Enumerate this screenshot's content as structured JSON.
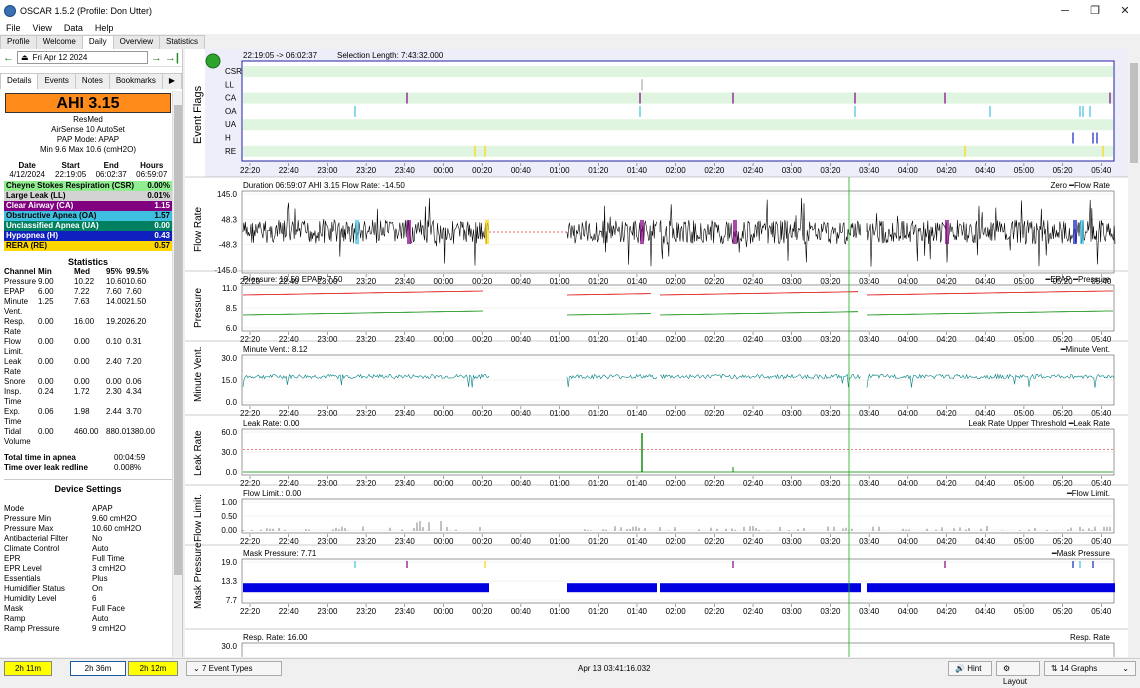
{
  "window": {
    "title": "OSCAR 1.5.2 (Profile: Don Utter)",
    "min": "─",
    "max": "❐",
    "close": "✕"
  },
  "menu": [
    "File",
    "View",
    "Data",
    "Help"
  ],
  "tabs": [
    "Profile",
    "Welcome",
    "Daily",
    "Overview",
    "Statistics"
  ],
  "date": {
    "value": "Fri Apr 12 2024"
  },
  "subtabs": [
    "Details",
    "Events",
    "Notes",
    "Bookmarks"
  ],
  "summary": {
    "ahi": "AHI 3.15",
    "brand": "ResMed",
    "model": "AirSense 10 AutoSet",
    "mode": "PAP Mode: APAP",
    "pressure": "Min 9.6 Max 10.6 (cmH2O)"
  },
  "session": {
    "headers": [
      "Date",
      "Start",
      "End",
      "Hours"
    ],
    "row": [
      "4/12/2024",
      "22:19:05",
      "06:02:37",
      "06:59:07"
    ]
  },
  "events": [
    {
      "label": "Cheyne Stokes Respiration (CSR)",
      "value": "0.00%",
      "color": "#90ee90"
    },
    {
      "label": "Large Leak (LL)",
      "value": "0.01%",
      "color": "#d3d3d3"
    },
    {
      "label": "Clear Airway (CA)",
      "value": "1.15",
      "color": "#800080",
      "fg": "#fff"
    },
    {
      "label": "Obstructive Apnea (OA)",
      "value": "1.57",
      "color": "#40c0e0"
    },
    {
      "label": "Unclassified Apnea (UA)",
      "value": "0.00",
      "color": "#008060",
      "fg": "#fff"
    },
    {
      "label": "Hypopnea (H)",
      "value": "0.43",
      "color": "#1020c0",
      "fg": "#fff"
    },
    {
      "label": "RERA (RE)",
      "value": "0.57",
      "color": "#ffd700"
    }
  ],
  "statistics": {
    "title": "Statistics",
    "headers": [
      "Channel",
      "Min",
      "Med",
      "95%",
      "99.5%"
    ],
    "rows": [
      [
        "Pressure",
        "9.00",
        "10.22",
        "10.60",
        "10.60"
      ],
      [
        "EPAP",
        "6.00",
        "7.22",
        "7.60",
        "7.60"
      ],
      [
        "Minute Vent.",
        "1.25",
        "7.63",
        "14.00",
        "21.50"
      ],
      [
        "Resp. Rate",
        "0.00",
        "16.00",
        "19.20",
        "26.20"
      ],
      [
        "Flow Limit.",
        "0.00",
        "0.00",
        "0.10",
        "0.31"
      ],
      [
        "Leak Rate",
        "0.00",
        "0.00",
        "2.40",
        "7.20"
      ],
      [
        "Snore",
        "0.00",
        "0.00",
        "0.00",
        "0.06"
      ],
      [
        "Insp. Time",
        "0.24",
        "1.72",
        "2.30",
        "4.34"
      ],
      [
        "Exp. Time",
        "0.06",
        "1.98",
        "2.44",
        "3.70"
      ],
      [
        "Tidal Volume",
        "0.00",
        "460.00",
        "880.0",
        "1380.00"
      ]
    ],
    "apnea_label": "Total time in apnea",
    "apnea_value": "00:04:59",
    "leak_label": "Time over leak redline",
    "leak_value": "0.008%"
  },
  "device": {
    "title": "Device Settings",
    "rows": [
      [
        "Mode",
        "APAP"
      ],
      [
        "Pressure Min",
        "9.60 cmH2O"
      ],
      [
        "Pressure Max",
        "10.60 cmH2O"
      ],
      [
        "Antibacterial Filter",
        "No"
      ],
      [
        "Climate Control",
        "Auto"
      ],
      [
        "EPR",
        "Full Time"
      ],
      [
        "EPR Level",
        "3 cmH2O"
      ],
      [
        "Essentials",
        "Plus"
      ],
      [
        "Humidifier Status",
        "On"
      ],
      [
        "Humidity Level",
        "6"
      ],
      [
        "Mask",
        "Full Face"
      ],
      [
        "Ramp",
        "Auto"
      ],
      [
        "Ramp Pressure",
        "9 cmH2O"
      ]
    ]
  },
  "bottom": {
    "btn1": "2h 11m",
    "btn2": "2h 36m",
    "btn3": "2h 12m",
    "event_types": "7 Event Types",
    "timestamp": "Apr 13 03:41:16.032",
    "hint": "Hint",
    "layout": "Layout",
    "graphs": "14 Graphs"
  },
  "time_ticks": [
    "22:20",
    "22:40",
    "23:00",
    "23:20",
    "23:40",
    "00:00",
    "00:20",
    "00:40",
    "01:00",
    "01:20",
    "01:40",
    "02:00",
    "02:20",
    "02:40",
    "03:00",
    "03:20",
    "03:40",
    "04:00",
    "04:20",
    "04:40",
    "05:00",
    "05:20",
    "05:40"
  ],
  "event_flags": {
    "label": "Event Flags",
    "range": "22:19:05 -> 06:02:37",
    "selection": "Selection Length: 7:43:32.000",
    "rows": [
      "CSR",
      "LL",
      "CA",
      "OA",
      "UA",
      "H",
      "RE"
    ]
  },
  "graphs": [
    {
      "label": "Flow Rate",
      "title": "Duration 06:59:07 AHI 3.15 Flow Rate: -14.50",
      "legend": "Zero ━Flow Rate",
      "ticks": [
        "145.0",
        "48.3",
        "-48.3",
        "-145.0"
      ],
      "color": "#000"
    },
    {
      "label": "Pressure",
      "title": "Pressure: 10.50 EPAP: 7.50",
      "legend": "━EPAP ━Pressure",
      "ticks": [
        "11.0",
        "8.5",
        "6.0"
      ],
      "color": "#d00"
    },
    {
      "label": "Minute Vent.",
      "title": "Minute Vent.: 8.12",
      "legend": "━Minute Vent.",
      "ticks": [
        "30.0",
        "15.0",
        "0.0"
      ],
      "color": "#008080"
    },
    {
      "label": "Leak Rate",
      "title": "Leak Rate: 0.00",
      "legend": "Leak Rate Upper Threshold ━Leak Rate",
      "ticks": [
        "60.0",
        "30.0",
        "0.0"
      ],
      "color": "#008000"
    },
    {
      "label": "Flow Limit.",
      "title": "Flow Limit.: 0.00",
      "legend": "━Flow Limit.",
      "ticks": [
        "1.00",
        "0.50",
        "0.00"
      ],
      "color": "#333"
    },
    {
      "label": "Mask Pressure",
      "title": "Mask Pressure: 7.71",
      "legend": "━Mask Pressure",
      "ticks": [
        "19.0",
        "13.3",
        "7.7"
      ],
      "color": "#0000e0"
    },
    {
      "label": "",
      "title": "Resp. Rate: 16.00",
      "legend": "Resp. Rate",
      "ticks": [
        "30.0"
      ],
      "color": "#800080"
    }
  ]
}
